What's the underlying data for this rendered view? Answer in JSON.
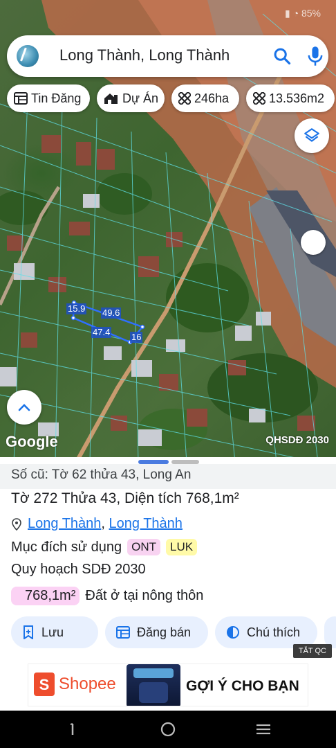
{
  "search": {
    "query": "Long Thành, Long Thành"
  },
  "chips": [
    {
      "icon": "list-icon",
      "label": "Tin Đăng"
    },
    {
      "icon": "home-icon",
      "label": "Dự Án"
    },
    {
      "icon": "ruler-icon",
      "label": "246ha"
    },
    {
      "icon": "ruler-icon",
      "label": "13.536m2"
    }
  ],
  "map": {
    "attribution": "Google",
    "overlay_label": "QHSDĐ 2030",
    "dimensions": [
      "15.9",
      "49.6",
      "47.4",
      "16"
    ]
  },
  "sheet": {
    "old_reference": "Số cũ: Tờ 62 thửa 43, Long An",
    "parcel_title": "Tờ 272 Thửa 43, Diện tích 768,1m²",
    "location_link_1": "Long Thành",
    "location_separator": ", ",
    "location_link_2": "Long Thành",
    "purpose_label": "Mục đích sử dụng",
    "tags": [
      "ONT",
      "LUK"
    ],
    "plan_label": "Quy hoạch SDĐ 2030",
    "area_value": "768,1m²",
    "area_desc": "Đất ở tại nông thôn",
    "actions": [
      {
        "icon": "bookmark-add-icon",
        "label": "Lưu"
      },
      {
        "icon": "list-alt-icon",
        "label": "Đăng bán"
      },
      {
        "icon": "contrast-icon",
        "label": "Chú thích"
      }
    ]
  },
  "ad": {
    "label": "TẮT QC",
    "brand": "Shopee",
    "headline": "GỢI Ý CHO BẠN"
  },
  "colors": {
    "accent": "#1a73e8",
    "chip_bg": "#e8f0fe",
    "ont_tag": "#f8d3f1",
    "luk_tag": "#fffaa8",
    "parcel_outline": "#2f6fff",
    "shopee": "#ee4d2d"
  }
}
